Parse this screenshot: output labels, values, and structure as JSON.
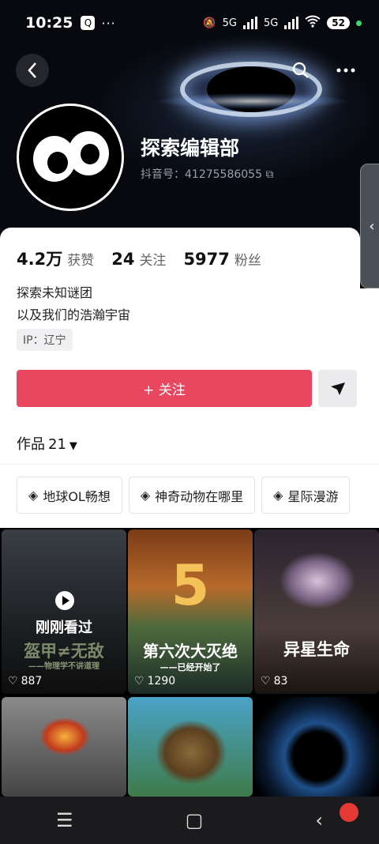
{
  "status": {
    "time": "10:25",
    "dots": "···",
    "net1": "5G",
    "net2": "5G",
    "battery": "52"
  },
  "profile": {
    "name": "探索编辑部",
    "douyin_id": "抖音号：41275586055"
  },
  "stats": [
    {
      "value": "4.2万",
      "label": "获赞"
    },
    {
      "value": "24",
      "label": "关注"
    },
    {
      "value": "5977",
      "label": "粉丝"
    }
  ],
  "bio": {
    "line1": "探索未知谜团",
    "line2": "以及我们的浩瀚宇宙"
  },
  "ip": "IP：辽宁",
  "follow_button": "+ 关注",
  "works": {
    "label": "作品",
    "count": "21"
  },
  "collections": [
    "地球OL畅想",
    "神奇动物在哪里",
    "星际漫游"
  ],
  "videos": [
    {
      "badge": "刚刚看过",
      "title": "盔甲≠无敌",
      "subtitle": "——物理学不讲道理",
      "likes": "887"
    },
    {
      "title_num": "5",
      "title": "第六次大灭绝",
      "subtitle": "——已经开始了",
      "likes": "1290"
    },
    {
      "title": "异星生命",
      "likes": "83"
    },
    {},
    {},
    {}
  ],
  "icons": {
    "back": "back-arrow-icon",
    "search": "search-icon",
    "more": "more-icon",
    "side": "chevron-left-icon"
  }
}
